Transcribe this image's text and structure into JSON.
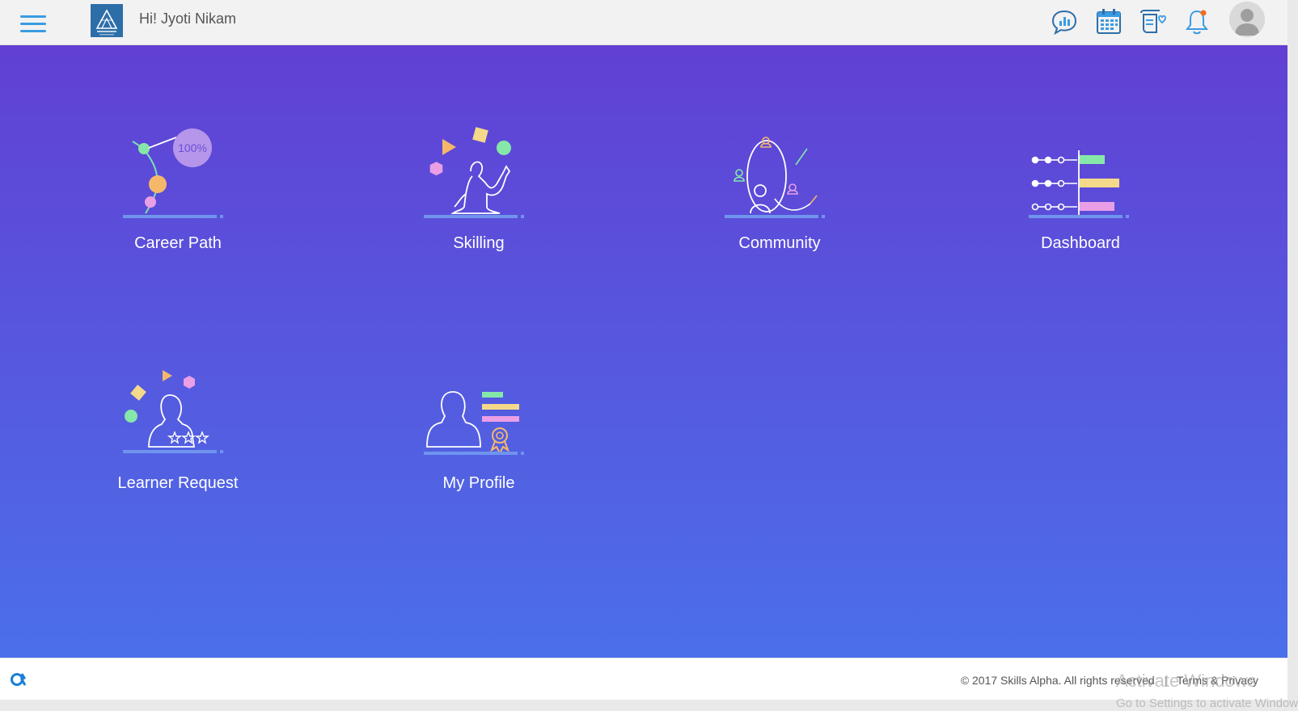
{
  "header": {
    "greeting": "Hi! Jyoti Nikam",
    "icons": [
      "chat-analytics-icon",
      "calendar-icon",
      "feedback-icon",
      "bell-icon",
      "user-avatar"
    ],
    "accent": "#3a9be3",
    "notification_dot": "#f26b21"
  },
  "tiles": [
    {
      "label": "Career Path",
      "icon": "career-path-icon"
    },
    {
      "label": "Skilling",
      "icon": "skilling-icon"
    },
    {
      "label": "Community",
      "icon": "community-icon"
    },
    {
      "label": "Dashboard",
      "icon": "dashboard-icon"
    },
    {
      "label": "Learner Request",
      "icon": "learner-request-icon"
    },
    {
      "label": "My Profile",
      "icon": "my-profile-icon"
    }
  ],
  "career_badge": "100%",
  "hero_gradient": [
    "#6140d3",
    "#4b6fe9"
  ],
  "footer": {
    "copyright": "© 2017 Skills Alpha. All rights reserved",
    "separator": "|",
    "terms": "Terms & Privacy"
  },
  "watermark": {
    "title": "Activate Windows",
    "subtitle": "Go to Settings to activate Windows."
  }
}
